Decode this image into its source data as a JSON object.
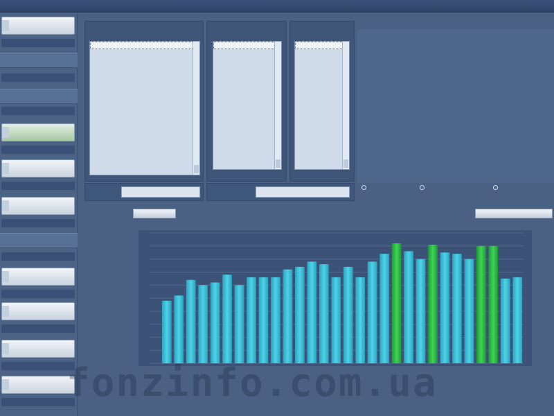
{
  "window": {
    "title": ""
  },
  "sidebar": {
    "items": [
      {
        "label": "",
        "variant": "button"
      },
      {
        "label": "",
        "variant": "sep"
      },
      {
        "label": "",
        "variant": "sep"
      },
      {
        "label": "",
        "variant": "green"
      },
      {
        "label": "",
        "variant": "button"
      },
      {
        "label": "",
        "variant": "button"
      },
      {
        "label": "",
        "variant": "sep"
      },
      {
        "label": "",
        "variant": "button"
      },
      {
        "label": "",
        "variant": "button"
      },
      {
        "label": "",
        "variant": "button"
      },
      {
        "label": "",
        "variant": "button"
      }
    ]
  },
  "panels": {
    "list1": {
      "header": "",
      "items": [
        "",
        ""
      ]
    },
    "list2": {
      "header": "",
      "items": [
        ""
      ]
    },
    "list3": {
      "header": "",
      "items": [
        "",
        "",
        "",
        ""
      ]
    }
  },
  "info": {
    "header": "",
    "rows": [
      {
        "key": "",
        "value": ""
      },
      {
        "key": "",
        "value": ""
      },
      {
        "key": "",
        "value": ""
      },
      {
        "key": "",
        "value": ""
      },
      {
        "key": "",
        "value": ""
      },
      {
        "key": "",
        "value": ""
      },
      {
        "key": "",
        "value": ""
      },
      {
        "key": "",
        "value": ""
      },
      {
        "key": "",
        "value": ""
      }
    ]
  },
  "filters": {
    "label1": "",
    "value1": "",
    "label2": "",
    "value2": ""
  },
  "options": {
    "radio1": "",
    "radio2": "",
    "radio3": "",
    "note": ""
  },
  "toolbar": {
    "button1": "",
    "button2": ""
  },
  "watermark": "fonzinfo.com.ua",
  "colors": {
    "cyan_bar": "#3fc2d8",
    "green_bar": "#2fbf46",
    "background": "#4a6184"
  },
  "chart_data": {
    "type": "bar",
    "values": [
      48,
      52,
      64,
      60,
      62,
      68,
      60,
      66,
      66,
      66,
      72,
      74,
      78,
      76,
      66,
      74,
      66,
      78,
      84,
      92,
      86,
      80,
      91,
      85,
      84,
      80,
      90,
      90,
      65,
      66
    ],
    "highlight": [
      false,
      false,
      false,
      false,
      false,
      false,
      false,
      false,
      false,
      false,
      false,
      false,
      false,
      false,
      false,
      false,
      false,
      false,
      false,
      true,
      false,
      false,
      true,
      false,
      false,
      false,
      true,
      true,
      false,
      false
    ],
    "ylim": [
      0,
      100
    ],
    "grid": true,
    "xlabel": "",
    "ylabel": ""
  }
}
